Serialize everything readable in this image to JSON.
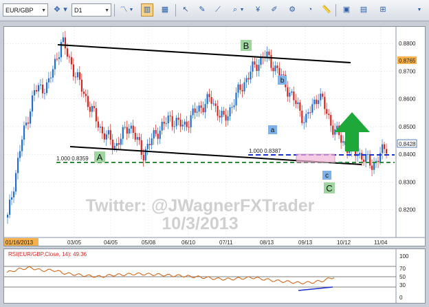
{
  "toolbar": {
    "symbol": "EUR/GBP",
    "timeframe": "D1",
    "icons": [
      "crosshair-icon",
      "candles-icon",
      "line-chart-icon",
      "bar-chart-icon",
      "grid-icon",
      "cursor-icon",
      "text-icon",
      "trendline-icon",
      "zoom-icon",
      "fibonacci-icon",
      "shapes-icon",
      "settings-icon",
      "ruler-icon",
      "screenshot-icon",
      "layout-icon",
      "indicators-icon"
    ]
  },
  "main_chart": {
    "price_ticks": [
      "0.8800",
      "0.8700",
      "0.8600",
      "0.8500",
      "0.8400",
      "0.8300",
      "0.8200"
    ],
    "last_price": "0.8765",
    "current_price": "0.8428",
    "date_ticks": [
      "01/16/2013",
      "03/05",
      "04/05",
      "05/08",
      "06/10",
      "07/11",
      "08/13",
      "09/13",
      "10/12",
      "11/04"
    ],
    "labels": {
      "A": "A",
      "B": "B",
      "C": "C",
      "a": "a",
      "b": "b",
      "c": "c"
    },
    "fib_label_1": "1.000 0.8359",
    "fib_label_2": "1.000 0.8387",
    "watermark_line1": "Twitter: @JWagnerFXTrader",
    "watermark_line2": "10/3/2013"
  },
  "rsi": {
    "title": "RSI(EUR/GBP,Close, 14): 49.36",
    "levels": [
      "100",
      "70",
      "50",
      "30",
      "0"
    ]
  },
  "colors": {
    "up_candle": "#1f6fd1",
    "down_candle": "#d7261e",
    "rsi_line": "#d2691e",
    "fib_green": "#2e8b3e",
    "fib_blue": "#1a2fd6",
    "arrow_green": "#1fa83a",
    "label_blue": "#7fb2e6",
    "label_green": "#9fd6a0",
    "last_price_bg": "#f6b04a"
  },
  "chart_data": {
    "type": "candlestick",
    "x": [
      "01/16/2013",
      "03/05",
      "04/05",
      "05/08",
      "06/10",
      "07/11",
      "08/13",
      "09/13",
      "10/12",
      "11/04"
    ],
    "ylim": [
      0.81,
      0.886
    ],
    "close_path": [
      [
        "01/16/2013",
        0.817
      ],
      [
        "01/25",
        0.844
      ],
      [
        "02/08",
        0.863
      ],
      [
        "02/15",
        0.865
      ],
      [
        "02/25",
        0.881
      ],
      [
        "03/05",
        0.869
      ],
      [
        "03/15",
        0.858
      ],
      [
        "03/25",
        0.848
      ],
      [
        "04/05",
        0.843
      ],
      [
        "04/12",
        0.851
      ],
      [
        "04/25",
        0.84
      ],
      [
        "05/08",
        0.848
      ],
      [
        "05/20",
        0.853
      ],
      [
        "06/01",
        0.85
      ],
      [
        "06/10",
        0.856
      ],
      [
        "06/20",
        0.86
      ],
      [
        "07/01",
        0.852
      ],
      [
        "07/11",
        0.862
      ],
      [
        "07/19",
        0.87
      ],
      [
        "07/29",
        0.876
      ],
      [
        "08/05",
        0.87
      ],
      [
        "08/13",
        0.861
      ],
      [
        "08/20",
        0.852
      ],
      [
        "08/28",
        0.862
      ],
      [
        "09/03",
        0.85
      ],
      [
        "09/13",
        0.843
      ],
      [
        "09/20",
        0.84
      ],
      [
        "09/27",
        0.836
      ],
      [
        "10/03",
        0.8428
      ]
    ],
    "rsi_range": [
      0,
      100
    ],
    "rsi_path": [
      60,
      68,
      72,
      65,
      66,
      58,
      55,
      52,
      50,
      54,
      55,
      57,
      56,
      55,
      53,
      52,
      50,
      48,
      45,
      44,
      46,
      48,
      44,
      40,
      38,
      35,
      36,
      40,
      49.36
    ]
  }
}
